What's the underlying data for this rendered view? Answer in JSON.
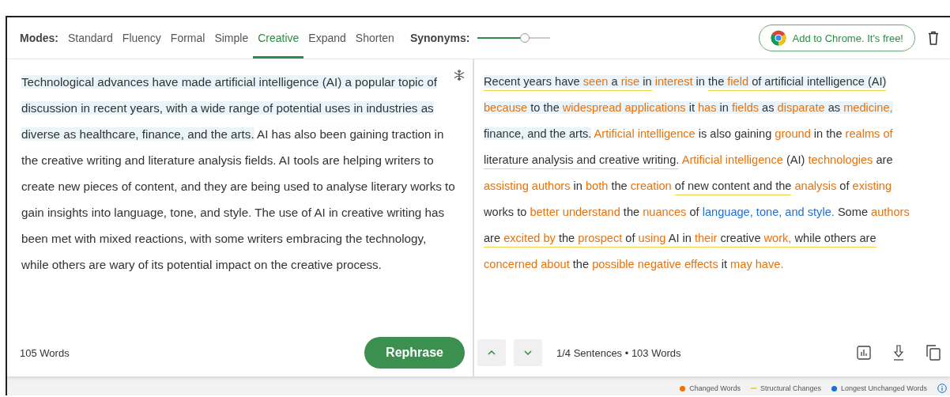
{
  "toolbar": {
    "modes_label": "Modes:",
    "modes": [
      {
        "label": "Standard",
        "selected": false
      },
      {
        "label": "Fluency",
        "selected": false
      },
      {
        "label": "Formal",
        "selected": false
      },
      {
        "label": "Simple",
        "selected": false
      },
      {
        "label": "Creative",
        "selected": true
      },
      {
        "label": "Expand",
        "selected": false
      },
      {
        "label": "Shorten",
        "selected": false
      }
    ],
    "synonyms": {
      "label": "Synonyms:",
      "level": 0.65
    },
    "chrome_button": "Add to Chrome. It's free!"
  },
  "input": {
    "sentences": [
      {
        "text": "Technological advances have made artificial intelligence (AI) a popular topic of discussion in recent years, with a wide range of potential uses in industries as diverse as healthcare, finance, and the arts.",
        "highlighted": true
      },
      {
        "text": " AI has also been gaining traction in the creative writing and literature analysis fields. AI tools are helping writers to create new pieces of content, and they are being used to analyse literary works to gain insights into language, tone, and style. The use of AI in creative writing has been met with mixed reactions, with some writers embracing the technology, while others are wary of its potential impact on the creative process.",
        "highlighted": false
      }
    ],
    "word_count": "105 Words",
    "rephrase_button": "Rephrase"
  },
  "output": {
    "sentences": [
      {
        "highlighted": true,
        "segments": [
          {
            "text": "Recent years have ",
            "kind": "plain",
            "underline": true
          },
          {
            "text": "seen",
            "kind": "changed",
            "underline": true
          },
          {
            "text": " a ",
            "kind": "plain",
            "underline": true
          },
          {
            "text": "rise",
            "kind": "changed",
            "underline": true
          },
          {
            "text": " in",
            "kind": "plain",
            "underline": true
          },
          {
            "text": " interest",
            "kind": "changed",
            "underline": false
          },
          {
            "text": " in ",
            "kind": "plain",
            "underline": false
          },
          {
            "text": "the ",
            "kind": "plain",
            "underline": true
          },
          {
            "text": "field",
            "kind": "changed",
            "underline": true
          },
          {
            "text": " of artificial intelligence (AI)",
            "kind": "plain",
            "underline": true
          },
          {
            "text": " because",
            "kind": "changed",
            "underline": false
          },
          {
            "text": " to the ",
            "kind": "plain",
            "underline": false
          },
          {
            "text": "widespread applications",
            "kind": "changed",
            "underline": false
          },
          {
            "text": " it ",
            "kind": "plain",
            "underline": false
          },
          {
            "text": "has",
            "kind": "changed",
            "underline": false
          },
          {
            "text": " in ",
            "kind": "plain",
            "underline": false
          },
          {
            "text": "fields",
            "kind": "changed",
            "underline": false
          },
          {
            "text": " as ",
            "kind": "plain",
            "underline": false
          },
          {
            "text": "disparate",
            "kind": "changed",
            "underline": false
          },
          {
            "text": " as ",
            "kind": "plain",
            "underline": false
          },
          {
            "text": "medicine,",
            "kind": "changed",
            "underline": false
          },
          {
            "text": " finance, and the arts.",
            "kind": "plain",
            "underline": false
          }
        ]
      },
      {
        "highlighted": false,
        "segments": [
          {
            "text": " Artificial intelligence",
            "kind": "changed",
            "underline": false
          },
          {
            "text": " is also gaining ",
            "kind": "plain",
            "underline": false
          },
          {
            "text": "ground",
            "kind": "changed",
            "underline": false
          },
          {
            "text": " in the ",
            "kind": "plain",
            "underline": false
          },
          {
            "text": "realms of ",
            "kind": "changed",
            "underline": false
          },
          {
            "text": "literature analysis and creative writing.",
            "kind": "plain",
            "underline": true
          }
        ]
      },
      {
        "highlighted": false,
        "segments": [
          {
            "text": " Artificial intelligence",
            "kind": "changed",
            "underline": false
          },
          {
            "text": " (AI) ",
            "kind": "plain",
            "underline": false
          },
          {
            "text": "technologies",
            "kind": "changed",
            "underline": false
          },
          {
            "text": " are ",
            "kind": "plain",
            "underline": false
          },
          {
            "text": "assisting authors",
            "kind": "changed",
            "underline": false
          },
          {
            "text": " in ",
            "kind": "plain",
            "underline": false
          },
          {
            "text": "both",
            "kind": "changed",
            "underline": false
          },
          {
            "text": " the ",
            "kind": "plain",
            "underline": false
          },
          {
            "text": "creation ",
            "kind": "changed",
            "underline": false
          },
          {
            "text": "of new content and the",
            "kind": "plain",
            "underline": true
          },
          {
            "text": " analysis",
            "kind": "changed",
            "underline": false
          },
          {
            "text": " of ",
            "kind": "plain",
            "underline": false
          },
          {
            "text": "existing",
            "kind": "changed",
            "underline": false
          },
          {
            "text": " works to ",
            "kind": "plain",
            "underline": false
          },
          {
            "text": "better understand",
            "kind": "changed",
            "underline": false
          },
          {
            "text": " the ",
            "kind": "plain",
            "underline": false
          },
          {
            "text": "nuances",
            "kind": "changed",
            "underline": false
          },
          {
            "text": " of ",
            "kind": "plain",
            "underline": false
          },
          {
            "text": "language, tone, and style.",
            "kind": "unchanged",
            "underline": false
          }
        ]
      },
      {
        "highlighted": false,
        "segments": [
          {
            "text": " Some ",
            "kind": "plain",
            "underline": false
          },
          {
            "text": "authors ",
            "kind": "changed",
            "underline": false
          },
          {
            "text": "are ",
            "kind": "plain",
            "underline": true
          },
          {
            "text": "excited by",
            "kind": "changed",
            "underline": true
          },
          {
            "text": " the ",
            "kind": "plain",
            "underline": true
          },
          {
            "text": "prospect",
            "kind": "changed",
            "underline": true
          },
          {
            "text": " of ",
            "kind": "plain",
            "underline": true
          },
          {
            "text": "using",
            "kind": "changed",
            "underline": true
          },
          {
            "text": " AI in ",
            "kind": "plain",
            "underline": true
          },
          {
            "text": "their",
            "kind": "changed",
            "underline": true
          },
          {
            "text": " creative ",
            "kind": "plain",
            "underline": true
          },
          {
            "text": "work,",
            "kind": "changed",
            "underline": true
          },
          {
            "text": " while others are",
            "kind": "plain",
            "underline": true
          },
          {
            "text": " concerned about",
            "kind": "changed",
            "underline": false
          },
          {
            "text": " the ",
            "kind": "plain",
            "underline": false
          },
          {
            "text": "possible negative effects",
            "kind": "changed",
            "underline": false
          },
          {
            "text": " it ",
            "kind": "plain",
            "underline": false
          },
          {
            "text": "may have.",
            "kind": "changed",
            "underline": false
          }
        ]
      }
    ],
    "sentence_info": "1/4 Sentences • 103 Words"
  },
  "legend": [
    {
      "label": "Changed Words",
      "kind": "dot",
      "color": "#e8720c"
    },
    {
      "label": "Structural Changes",
      "kind": "dash",
      "color": "#f2d544"
    },
    {
      "label": "Longest Unchanged Words",
      "kind": "dot",
      "color": "#1e6fd0"
    }
  ]
}
